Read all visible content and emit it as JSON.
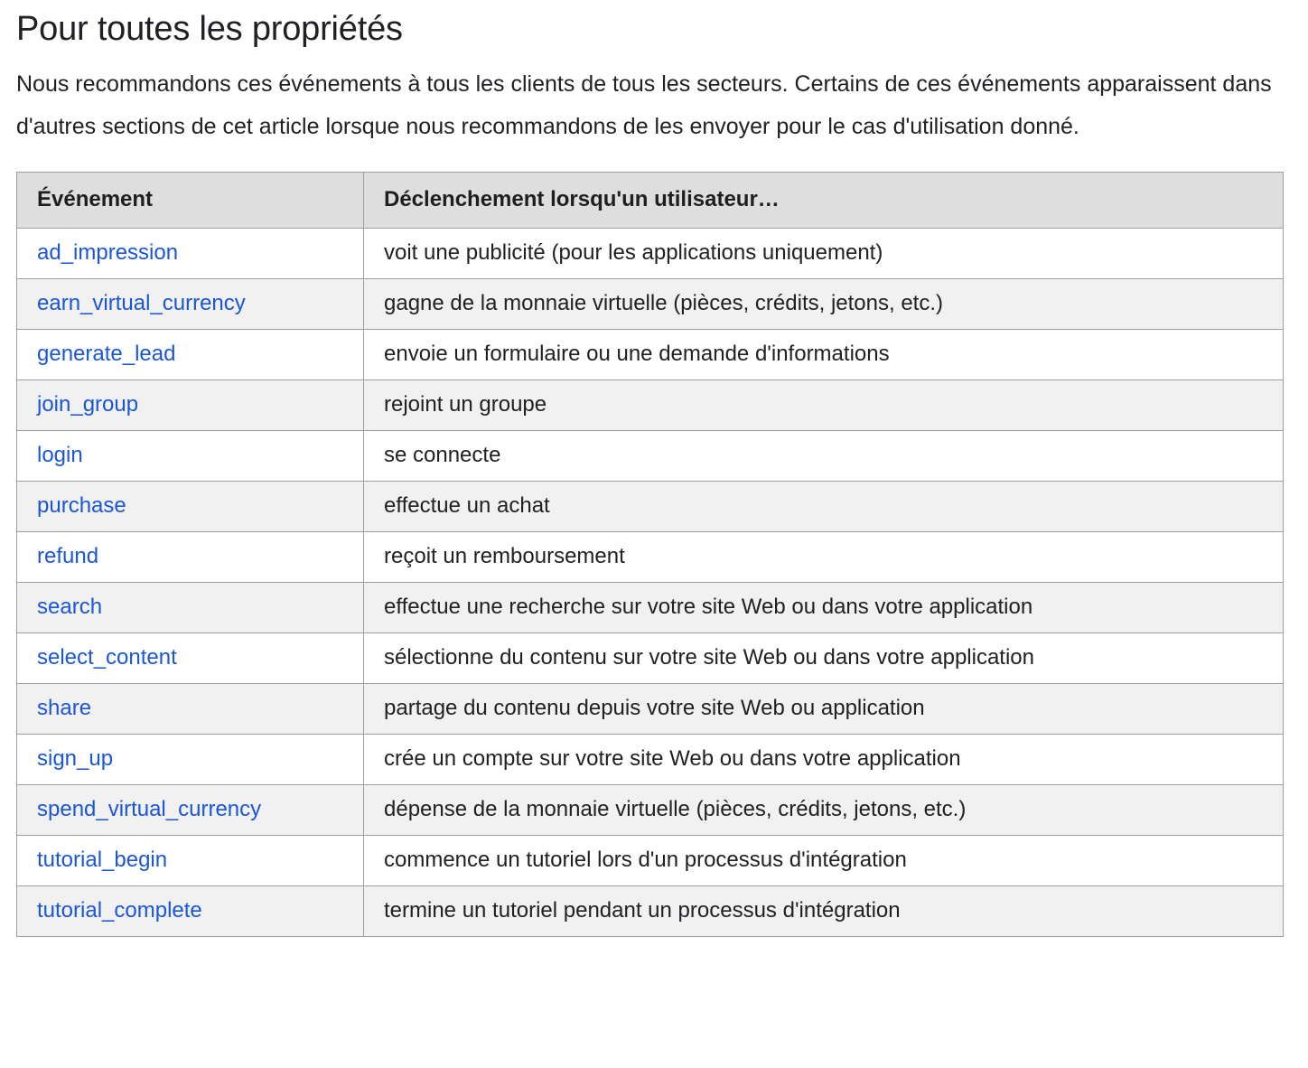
{
  "page": {
    "title": "Pour toutes les propriétés",
    "intro": "Nous recommandons ces événements à tous les clients de tous les secteurs. Certains de ces événements apparaissent dans d'autres sections de cet article lorsque nous recommandons de les envoyer pour le cas d'utilisation donné."
  },
  "colors": {
    "link": "#1a56d6",
    "text": "#202124",
    "header_background": "#dedede",
    "stripe_background": "#f1f1f1",
    "border": "#9e9e9e"
  },
  "table": {
    "columns": [
      "Événement",
      "Déclenchement lorsqu'un utilisateur…"
    ],
    "rows": [
      {
        "event": "ad_impression",
        "description": "voit une publicité (pour les applications uniquement)"
      },
      {
        "event": "earn_virtual_currency",
        "description": "gagne de la monnaie virtuelle (pièces, crédits, jetons, etc.)"
      },
      {
        "event": "generate_lead",
        "description": "envoie un formulaire ou une demande d'informations"
      },
      {
        "event": "join_group",
        "description": "rejoint un groupe"
      },
      {
        "event": "login",
        "description": "se connecte"
      },
      {
        "event": "purchase",
        "description": "effectue un achat"
      },
      {
        "event": "refund",
        "description": "reçoit un remboursement"
      },
      {
        "event": "search",
        "description": "effectue une recherche sur votre site Web ou dans votre application"
      },
      {
        "event": "select_content",
        "description": "sélectionne du contenu sur votre site Web ou dans votre application"
      },
      {
        "event": "share",
        "description": "partage du contenu depuis votre site Web ou application"
      },
      {
        "event": "sign_up",
        "description": "crée un compte sur votre site Web ou dans votre application"
      },
      {
        "event": "spend_virtual_currency",
        "description": "dépense de la monnaie virtuelle (pièces, crédits, jetons, etc.)"
      },
      {
        "event": "tutorial_begin",
        "description": "commence un tutoriel lors d'un processus d'intégration"
      },
      {
        "event": "tutorial_complete",
        "description": "termine un tutoriel pendant un processus d'intégration"
      }
    ]
  }
}
